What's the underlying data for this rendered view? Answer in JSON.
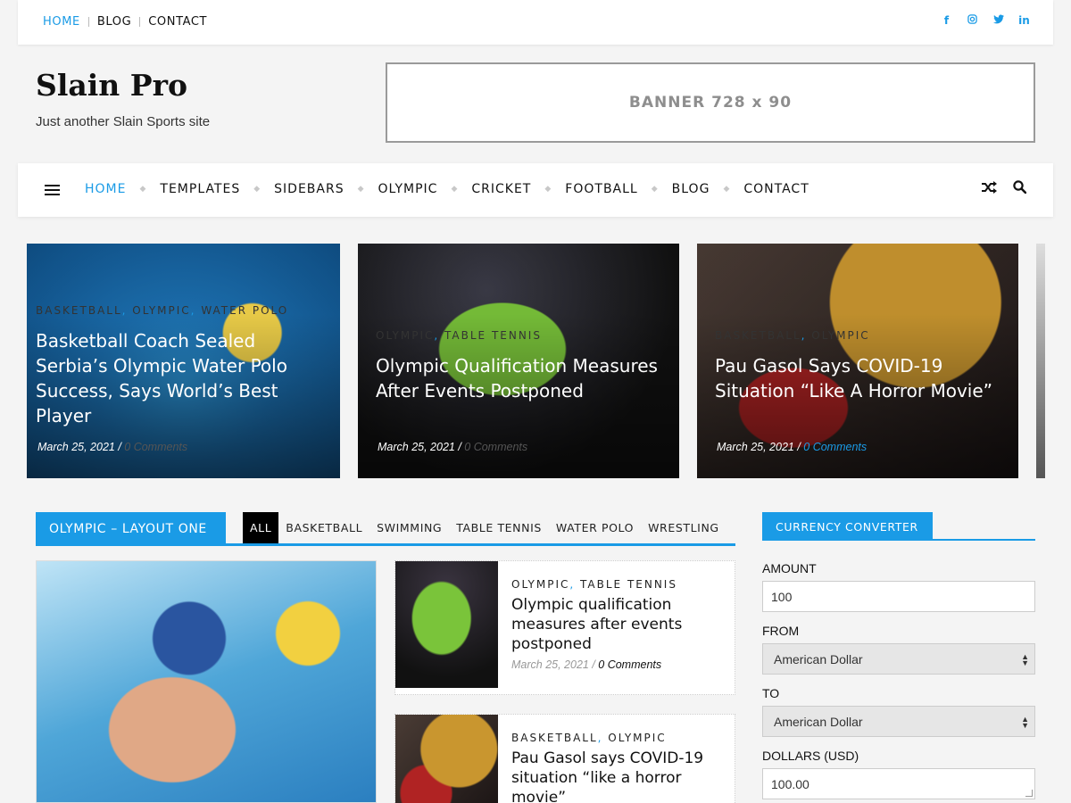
{
  "topbar": {
    "links": [
      {
        "label": "HOME",
        "active": true
      },
      {
        "label": "BLOG",
        "active": false
      },
      {
        "label": "CONTACT",
        "active": false
      }
    ],
    "social_icons": [
      "facebook-icon",
      "instagram-icon",
      "twitter-icon",
      "linkedin-icon"
    ]
  },
  "header": {
    "site_title": "Slain Pro",
    "tagline": "Just another Slain Sports site",
    "banner_text": "BANNER 728 x 90"
  },
  "mainnav": {
    "items": [
      "HOME",
      "TEMPLATES",
      "SIDEBARS",
      "OLYMPIC",
      "CRICKET",
      "FOOTBALL",
      "BLOG",
      "CONTACT"
    ],
    "active_index": 0
  },
  "slider": [
    {
      "categories": [
        "BASKETBALL",
        "OLYMPIC",
        "WATER POLO"
      ],
      "title": "Basketball Coach Sealed Serbia’s Olympic Water Polo Success, Says World’s Best Player",
      "date": "March 25, 2021",
      "comments": "0 Comments"
    },
    {
      "categories": [
        "OLYMPIC",
        "TABLE TENNIS"
      ],
      "title": "Olympic Qualification Measures After Events Postponed",
      "date": "March 25, 2021",
      "comments": "0 Comments"
    },
    {
      "categories": [
        "BASKETBALL",
        "OLYMPIC"
      ],
      "title": "Pau Gasol Says COVID-19 Situation “Like A Horror Movie”",
      "date": "March 25, 2021",
      "comments": "0 Comments"
    }
  ],
  "section": {
    "title": "OLYMPIC – LAYOUT ONE",
    "tabs": [
      "ALL",
      "BASKETBALL",
      "SWIMMING",
      "TABLE TENNIS",
      "WATER POLO",
      "WRESTLING"
    ],
    "active_tab": 0
  },
  "posts": [
    {
      "categories": [
        "OLYMPIC",
        "TABLE TENNIS"
      ],
      "title": "Olympic qualification measures after events postponed",
      "date": "March 25, 2021",
      "comments": "0 Comments"
    },
    {
      "categories": [
        "BASKETBALL",
        "OLYMPIC"
      ],
      "title": "Pau Gasol says COVID-19 situation “like a horror movie”"
    }
  ],
  "widget": {
    "title": "CURRENCY CONVERTER",
    "amount_label": "AMOUNT",
    "amount_value": "100",
    "from_label": "FROM",
    "from_value": "American Dollar",
    "to_label": "TO",
    "to_value": "American Dollar",
    "result_label": "DOLLARS (USD)",
    "result_value": "100.00"
  },
  "colors": {
    "accent": "#1a9be6"
  }
}
